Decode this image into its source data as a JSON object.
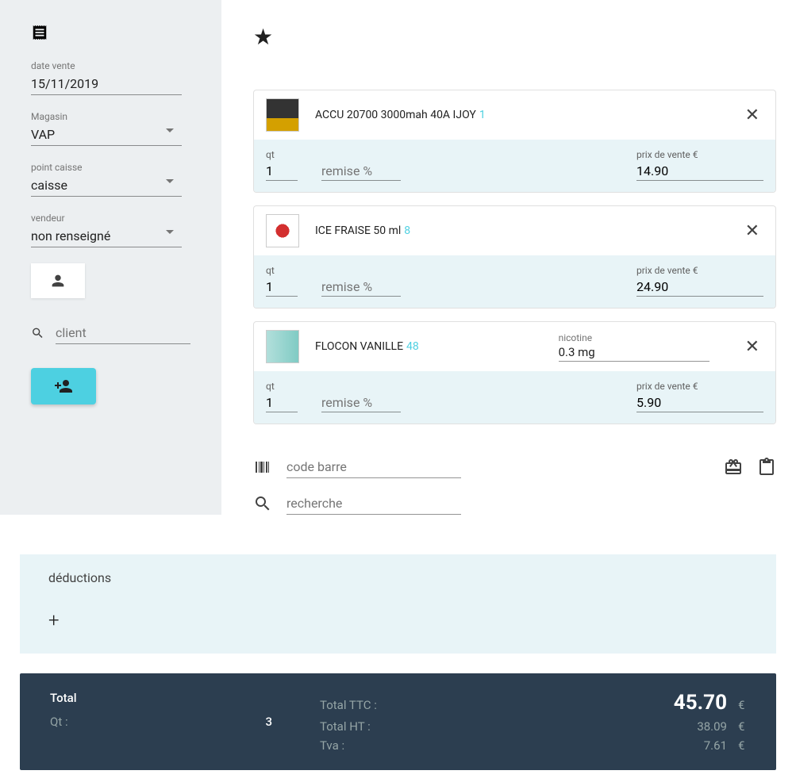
{
  "sidebar": {
    "date_label": "date vente",
    "date_value": "15/11/2019",
    "store_label": "Magasin",
    "store_value": "VAP",
    "register_label": "point caisse",
    "register_value": "caisse",
    "seller_label": "vendeur",
    "seller_value": "non renseigné",
    "client_placeholder": "client"
  },
  "items": [
    {
      "name": "ACCU 20700 3000mah 40A IJOY",
      "stock": "1",
      "qt_label": "qt",
      "qt_value": "1",
      "remise_placeholder": "remise %",
      "price_label": "prix de vente €",
      "price_value": "14.90"
    },
    {
      "name": "ICE FRAISE 50 ml",
      "stock": "8",
      "qt_label": "qt",
      "qt_value": "1",
      "remise_placeholder": "remise %",
      "price_label": "prix de vente €",
      "price_value": "24.90"
    },
    {
      "name": "FLOCON VANILLE",
      "stock": "48",
      "nicotine_label": "nicotine",
      "nicotine_value": "0.3 mg",
      "qt_label": "qt",
      "qt_value": "1",
      "remise_placeholder": "remise %",
      "price_label": "prix de vente €",
      "price_value": "5.90"
    }
  ],
  "inputs": {
    "barcode_placeholder": "code barre",
    "search_placeholder": "recherche"
  },
  "deductions": {
    "title": "déductions"
  },
  "totals": {
    "total_label": "Total",
    "qt_label": "Qt :",
    "qt_value": "3",
    "ttc_label": "Total TTC :",
    "ttc_value": "45.70",
    "ht_label": "Total HT :",
    "ht_value": "38.09",
    "tva_label": "Tva :",
    "tva_value": "7.61",
    "currency": "€"
  }
}
